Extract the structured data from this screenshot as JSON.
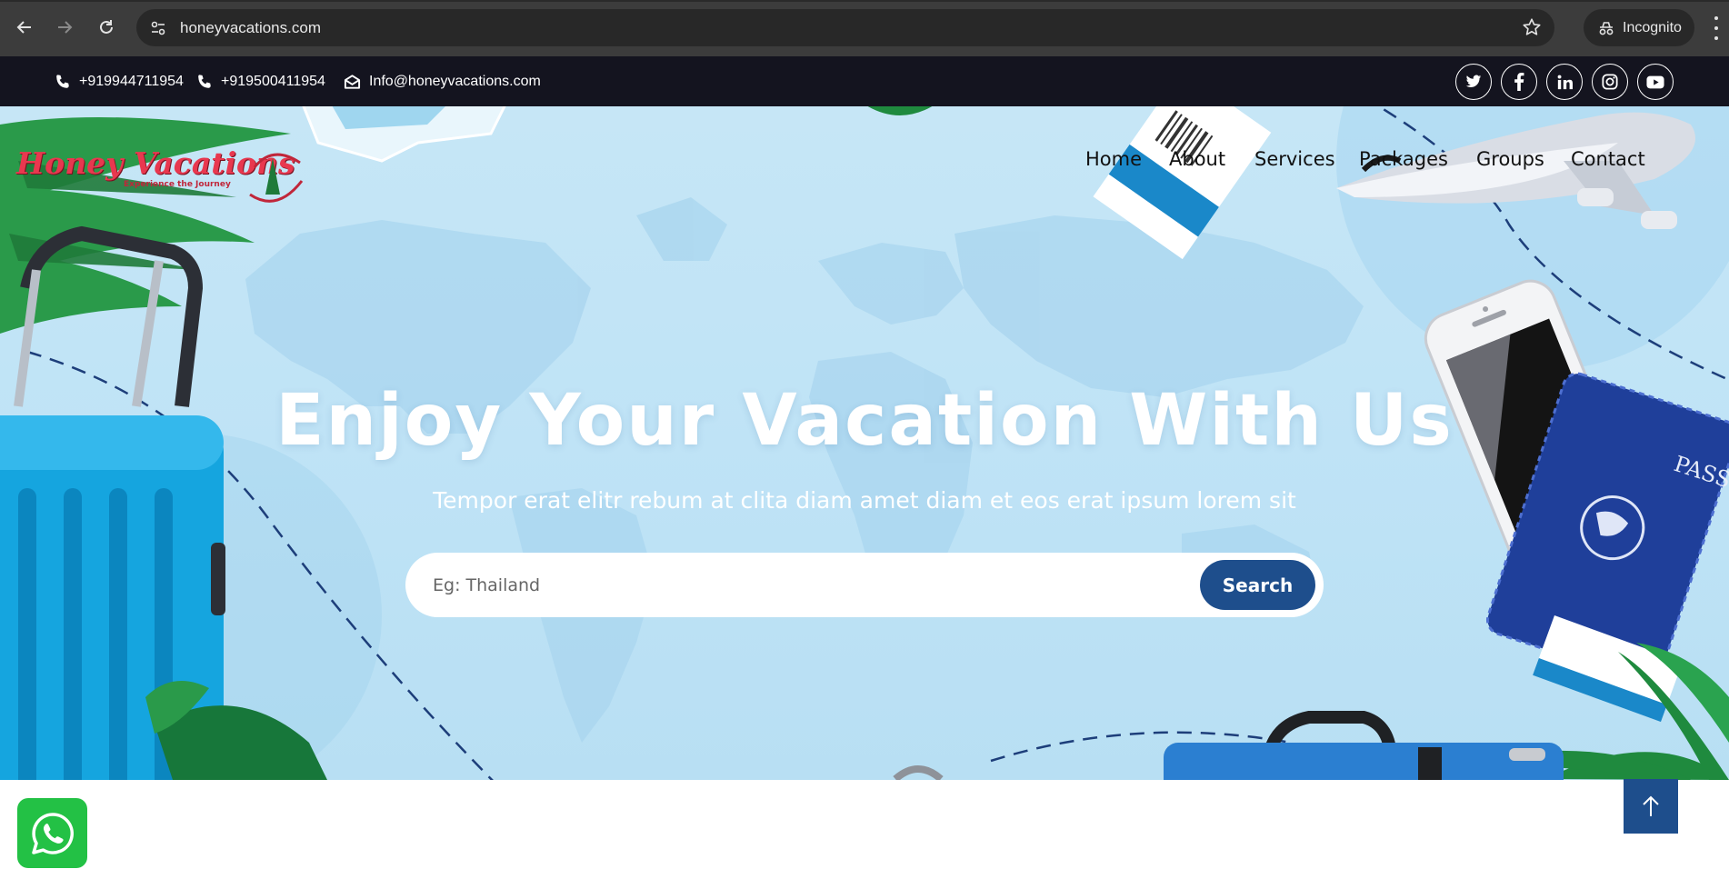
{
  "browser": {
    "url": "honeyvacations.com",
    "profile_label": "Incognito",
    "icons": [
      "back-arrow-icon",
      "forward-arrow-icon",
      "reload-icon",
      "site-info-icon",
      "bookmark-star-icon",
      "incognito-icon",
      "more-menu-icon"
    ]
  },
  "topbar": {
    "phone1": "+919944711954",
    "phone2": "+919500411954",
    "email": "Info@honeyvacations.com",
    "social": [
      "twitter",
      "facebook",
      "linkedin",
      "instagram",
      "youtube"
    ]
  },
  "logo": {
    "brand": "Honey Vacations",
    "tagline": "Experience the Journey"
  },
  "nav": {
    "items": [
      "Home",
      "About",
      "Services",
      "Packages",
      "Groups",
      "Contact"
    ]
  },
  "hero": {
    "title": "Enjoy Your Vacation With Us",
    "subtitle": "Tempor erat elitr rebum at clita diam amet diam et eos erat ipsum lorem sit",
    "search_placeholder": "Eg: Thailand",
    "search_button": "Search"
  },
  "colors": {
    "topbar": "#14141f",
    "accent": "#1e4e8c",
    "whatsapp": "#23c145",
    "logo": "#e8384f"
  }
}
